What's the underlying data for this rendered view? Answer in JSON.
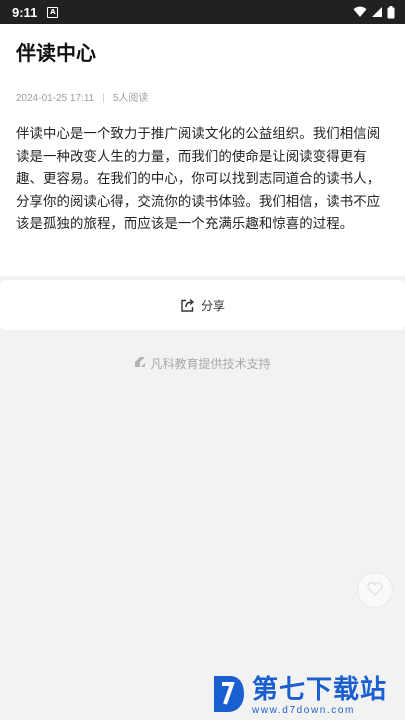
{
  "status_bar": {
    "time": "9:11",
    "app_icon_letter": "A",
    "icons": [
      "wifi-icon",
      "signal-icon",
      "battery-icon"
    ]
  },
  "article": {
    "title": "伴读中心",
    "date": "2024-01-25 17:11",
    "meta_separator": "|",
    "read_count": "5人阅读",
    "body": "伴读中心是一个致力于推广阅读文化的公益组织。我们相信阅读是一种改变人生的力量，而我们的使命是让阅读变得更有趣、更容易。在我们的中心，你可以找到志同道合的读书人，分享你的阅读心得，交流你的读书体验。我们相信，读书不应该是孤独的旅程，而应该是一个充满乐趣和惊喜的过程。"
  },
  "share": {
    "label": "分享",
    "icon": "share-icon"
  },
  "footer": {
    "support_text": "凡科教育提供技术支持",
    "icon": "fanke-logo-icon"
  },
  "watermark": {
    "title": "第七下载站",
    "url": "www.d7down.com"
  },
  "colors": {
    "status_bar_bg": "#212121",
    "page_bg": "#f2f2f2",
    "card_bg": "#ffffff",
    "meta_text": "#9e9e9e",
    "watermark_blue": "#1a5fd0"
  }
}
